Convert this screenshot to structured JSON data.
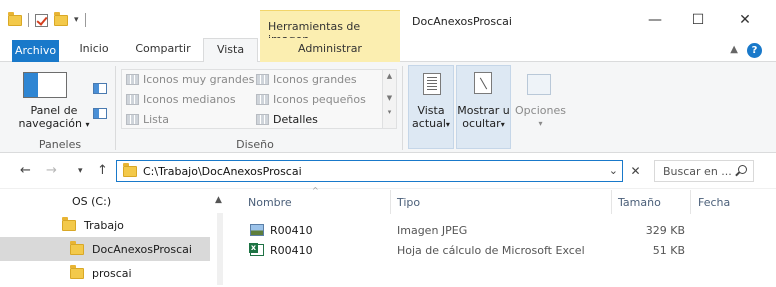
{
  "window": {
    "context_tab": "Herramientas de imagen",
    "title": "DocAnexosProscai",
    "minimize": "—",
    "maximize": "☐",
    "close": "✕"
  },
  "ribbon_tabs": {
    "file": "Archivo",
    "home": "Inicio",
    "share": "Compartir",
    "view": "Vista",
    "manage": "Administrar",
    "help": "?"
  },
  "ribbon": {
    "panes_group": "Paneles",
    "nav_pane_line1": "Panel de",
    "nav_pane_line2": "navegación",
    "layout_group": "Diseño",
    "layout_items": [
      "Iconos muy grandes",
      "Iconos grandes",
      "Iconos medianos",
      "Iconos pequeños",
      "Lista",
      "Detalles"
    ],
    "current_view_line1": "Vista",
    "current_view_line2": "actual",
    "show_hide_line1": "Mostrar u",
    "show_hide_line2": "ocultar",
    "options": "Opciones"
  },
  "address": {
    "path": "C:\\Trabajo\\DocAnexosProscai",
    "search_placeholder": "Buscar en ..."
  },
  "nav_tree": [
    {
      "label": "OS (C:)"
    },
    {
      "label": "Trabajo"
    },
    {
      "label": "DocAnexosProscai"
    },
    {
      "label": "proscai"
    }
  ],
  "columns": {
    "name": "Nombre",
    "type": "Tipo",
    "size": "Tamaño",
    "date": "Fecha"
  },
  "files": [
    {
      "name": "R00410",
      "type": "Imagen JPEG",
      "size": "329 KB",
      "icon": "jpeg-icon"
    },
    {
      "name": "R00410",
      "type": "Hoja de cálculo de Microsoft Excel",
      "size": "51 KB",
      "icon": "excel-icon"
    }
  ],
  "colors": {
    "accent": "#1979ca",
    "context_tab": "#fbeeb0",
    "selected_row": "#d9d9d9",
    "folder": "#f3c94a"
  }
}
